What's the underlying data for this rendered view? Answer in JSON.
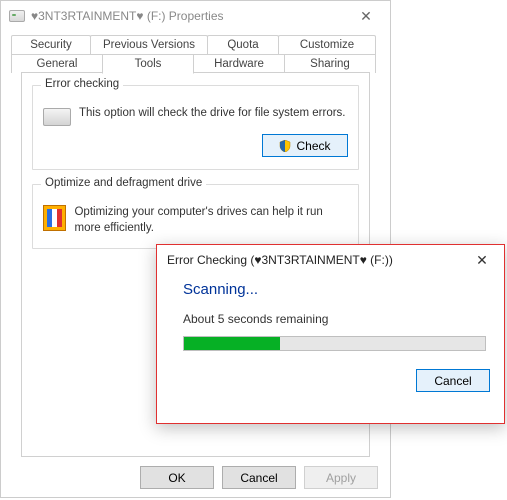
{
  "window": {
    "title": "♥3NT3RTAINMENT♥ (F:) Properties",
    "tabs_back": [
      "Security",
      "Previous Versions",
      "Quota",
      "Customize"
    ],
    "tabs_front": [
      "General",
      "Tools",
      "Hardware",
      "Sharing"
    ],
    "selected_tab": "Tools"
  },
  "errorCheck": {
    "legend": "Error checking",
    "text": "This option will check the drive for file system errors.",
    "button": "Check"
  },
  "defrag": {
    "legend": "Optimize and defragment drive",
    "text": "Optimizing your computer's drives can help it run more efficiently."
  },
  "buttons": {
    "ok": "OK",
    "cancel": "Cancel",
    "apply": "Apply"
  },
  "dialog": {
    "title": "Error Checking (♥3NT3RTAINMENT♥ (F:))",
    "status": "Scanning...",
    "remaining": "About 5 seconds remaining",
    "progress_percent": 32,
    "cancel": "Cancel"
  }
}
